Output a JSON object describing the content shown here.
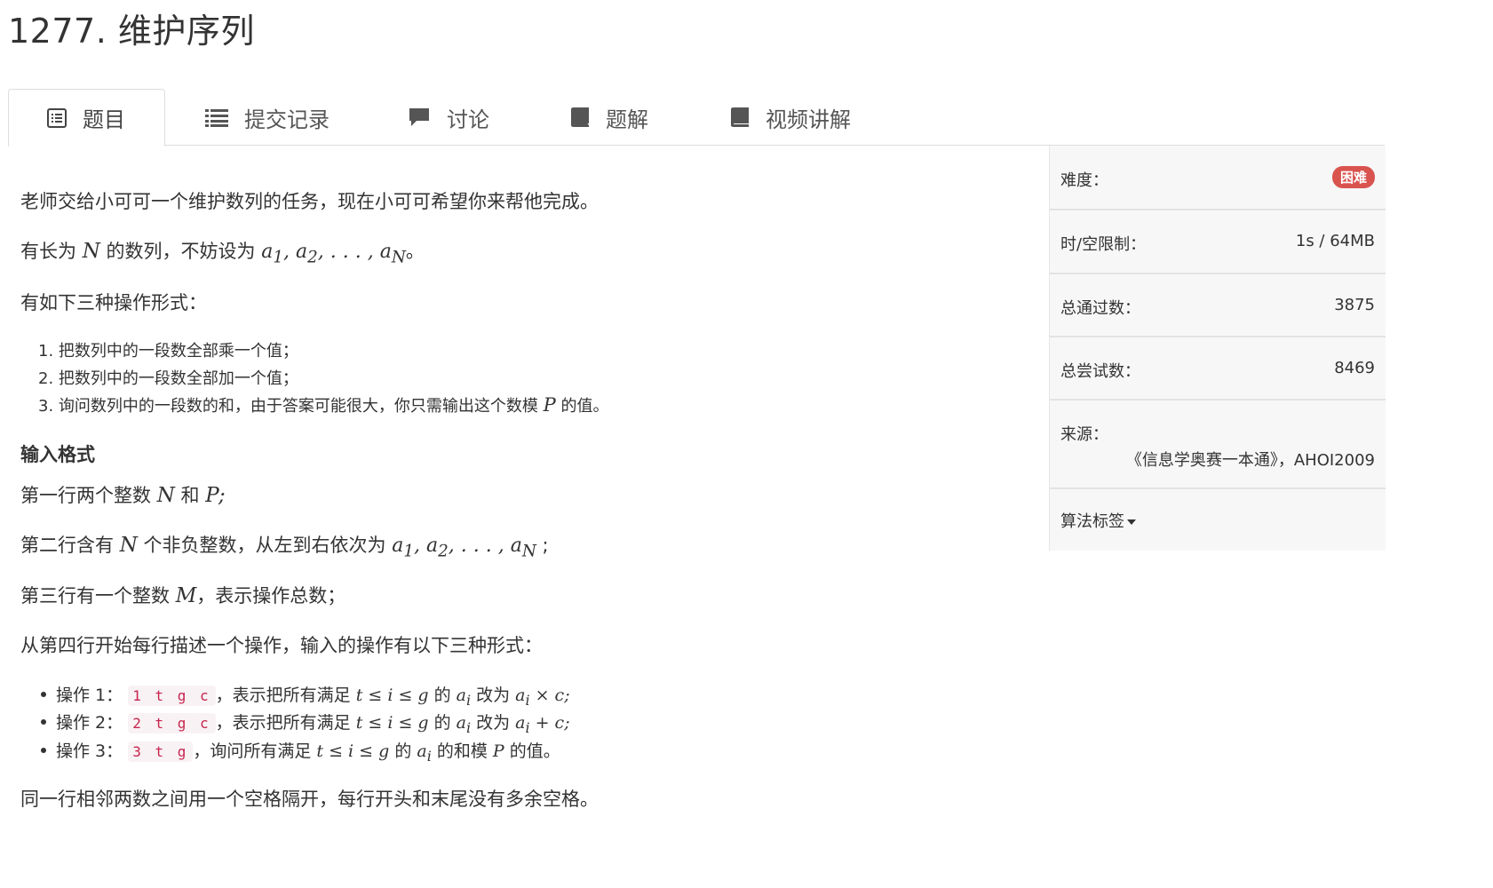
{
  "problem": {
    "title": "1277. 维护序列"
  },
  "tabs": [
    {
      "label": "题目",
      "icon": "list-alt-icon",
      "active": true
    },
    {
      "label": "提交记录",
      "icon": "list-icon"
    },
    {
      "label": "讨论",
      "icon": "comment-icon"
    },
    {
      "label": "题解",
      "icon": "book-icon"
    },
    {
      "label": "视频讲解",
      "icon": "book-icon"
    }
  ],
  "body": {
    "intro": "老师交给小可可一个维护数列的任务，现在小可可希望你来帮他完成。",
    "seq_prefix": "有长为",
    "seq_mid": "的数列，不妨设为",
    "seq_suffix": "。",
    "ops_intro": "有如下三种操作形式：",
    "ops_list": [
      "1. 把数列中的一段数全部乘一个值；",
      "2. 把数列中的一段数全部加一个值；",
      "3. 询问数列中的一段数的和，由于答案可能很大，你只需输出这个数模"
    ],
    "ops_list3_suffix": "的值。",
    "input_heading": "输入格式",
    "line1_prefix": "第一行两个整数",
    "line1_and": "和",
    "line2_prefix": "第二行含有",
    "line2_mid": "个非负整数，从左到右依次为",
    "line3_prefix": "第三行有一个整数",
    "line3_suffix": "，表示操作总数；",
    "line4": "从第四行开始每行描述一个操作，输入的操作有以下三种形式：",
    "op_items": [
      {
        "label": "操作 1：",
        "code": "1 t g c",
        "desc": "，表示把所有满足",
        "mid": "的",
        "verb": "改为",
        "expr": "a<sub>i</sub> × c;"
      },
      {
        "label": "操作 2：",
        "code": "2 t g c",
        "desc": "，表示把所有满足",
        "mid": "的",
        "verb": "改为",
        "expr": "a<sub>i</sub> + c;"
      },
      {
        "label": "操作 3：",
        "code": "3 t g",
        "desc": "，询问所有满足",
        "mid": "的",
        "verb": "的和模",
        "expr": ""
      }
    ],
    "op3_suffix": "的值。",
    "separator_note": "同一行相邻两数之间用一个空格隔开，每行开头和末尾没有多余空格。"
  },
  "sidebar": {
    "difficulty_label": "难度：",
    "difficulty_value": "困难",
    "limit_label": "时/空限制：",
    "limit_value": "1s / 64MB",
    "accepted_label": "总通过数：",
    "accepted_value": "3875",
    "attempts_label": "总尝试数：",
    "attempts_value": "8469",
    "source_label": "来源：",
    "source_value": "《信息学奥赛一本通》，AHOI2009",
    "tags_label": "算法标签"
  },
  "colors": {
    "badge": "#d9534f",
    "code_text": "#c7254e",
    "code_bg": "#f9f2f4"
  }
}
